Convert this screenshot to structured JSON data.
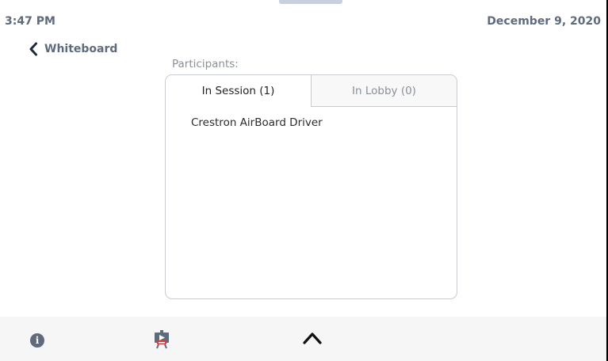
{
  "status_bar": {
    "time": "3:47 PM",
    "date": "December 9, 2020"
  },
  "nav": {
    "back_label": "Whiteboard"
  },
  "participants": {
    "heading": "Participants:",
    "tabs": [
      {
        "label": "In Session (1)",
        "active": true
      },
      {
        "label": "In Lobby (0)",
        "active": false
      }
    ],
    "items": [
      "Crestron AirBoard Driver"
    ]
  },
  "footer": {
    "icons": [
      "info-icon",
      "presenter-icon",
      "chevron-up-icon"
    ]
  },
  "colors": {
    "muted_text": "#5f6b7d",
    "panel_border": "#c8cbd0",
    "presenter_red": "#e03b3b"
  }
}
